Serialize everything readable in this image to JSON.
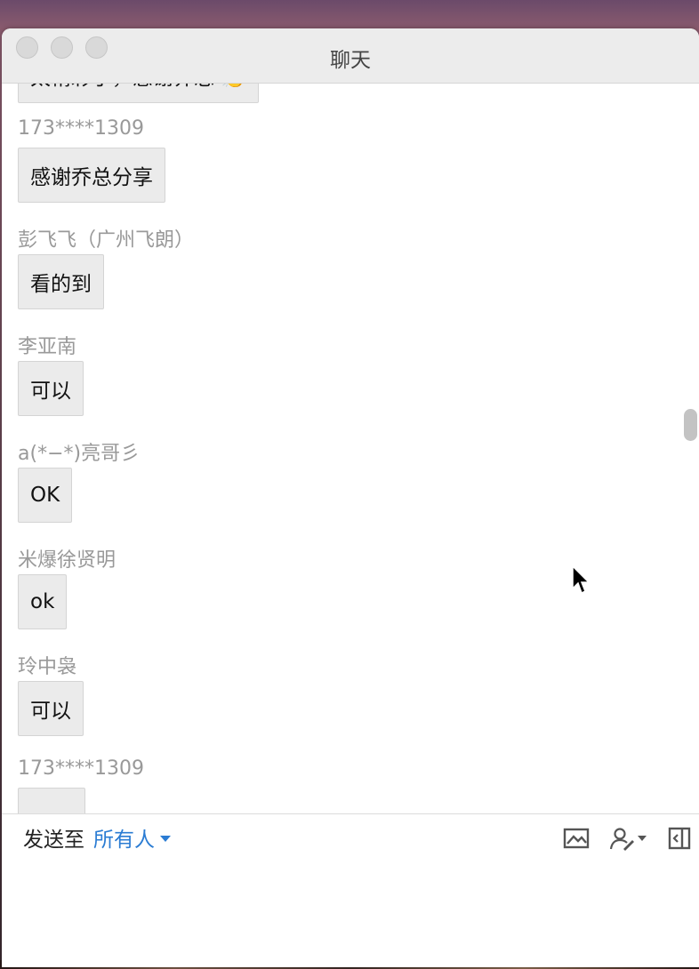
{
  "window": {
    "title": "聊天"
  },
  "messages": [
    {
      "sender": "",
      "text": "太精彩了，感谢乔总 👏"
    },
    {
      "sender": "173****1309",
      "text": "感谢乔总分享"
    },
    {
      "sender": "彭飞飞（广州飞朗）",
      "text": "看的到"
    },
    {
      "sender": "李亚南",
      "text": "可以"
    },
    {
      "sender": "a(*−*)亮哥彡",
      "text": "OK"
    },
    {
      "sender": "米爆徐贤明",
      "text": "ok"
    },
    {
      "sender": "玲中袅",
      "text": "可以"
    },
    {
      "sender": "173****1309",
      "text": ""
    }
  ],
  "composer": {
    "send_to_label": "发送至",
    "recipient": "所有人",
    "icons": [
      "image-icon",
      "annotate-icon",
      "popout-icon"
    ]
  },
  "colors": {
    "accent": "#2b7cd3",
    "sender": "#999999",
    "bubble": "#ebebeb"
  }
}
